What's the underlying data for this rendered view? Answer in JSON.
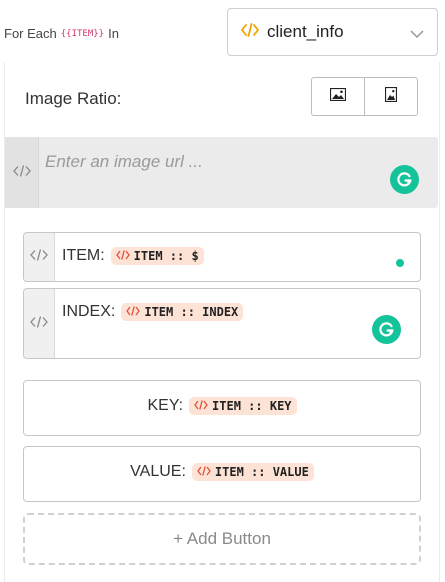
{
  "header": {
    "for_each": "For Each",
    "item_tag": "{{ITEM}}",
    "in_word": "In",
    "select_value": "client_info"
  },
  "image_ratio": {
    "label": "Image Ratio:"
  },
  "url_field": {
    "placeholder": "Enter an image url ..."
  },
  "fields": {
    "item": {
      "label": "ITEM:",
      "chip": "ITEM :: $"
    },
    "index": {
      "label": "INDEX:",
      "chip": "ITEM :: INDEX"
    },
    "key": {
      "label": "KEY:",
      "chip": "ITEM :: KEY"
    },
    "value": {
      "label": "VALUE:",
      "chip": "ITEM :: VALUE"
    }
  },
  "add_button": {
    "label": "+ Add Button"
  },
  "colors": {
    "accent_orange": "#f0a500",
    "grammarly_green": "#15c39a",
    "chip_bg": "#fde3d6",
    "item_tag_pink": "#d6336c"
  },
  "icons": {
    "code": "code-icon",
    "chevron": "chevron-down-icon",
    "landscape_image": "image-landscape-icon",
    "portrait_image": "image-portrait-icon",
    "grammarly": "grammarly-icon"
  }
}
